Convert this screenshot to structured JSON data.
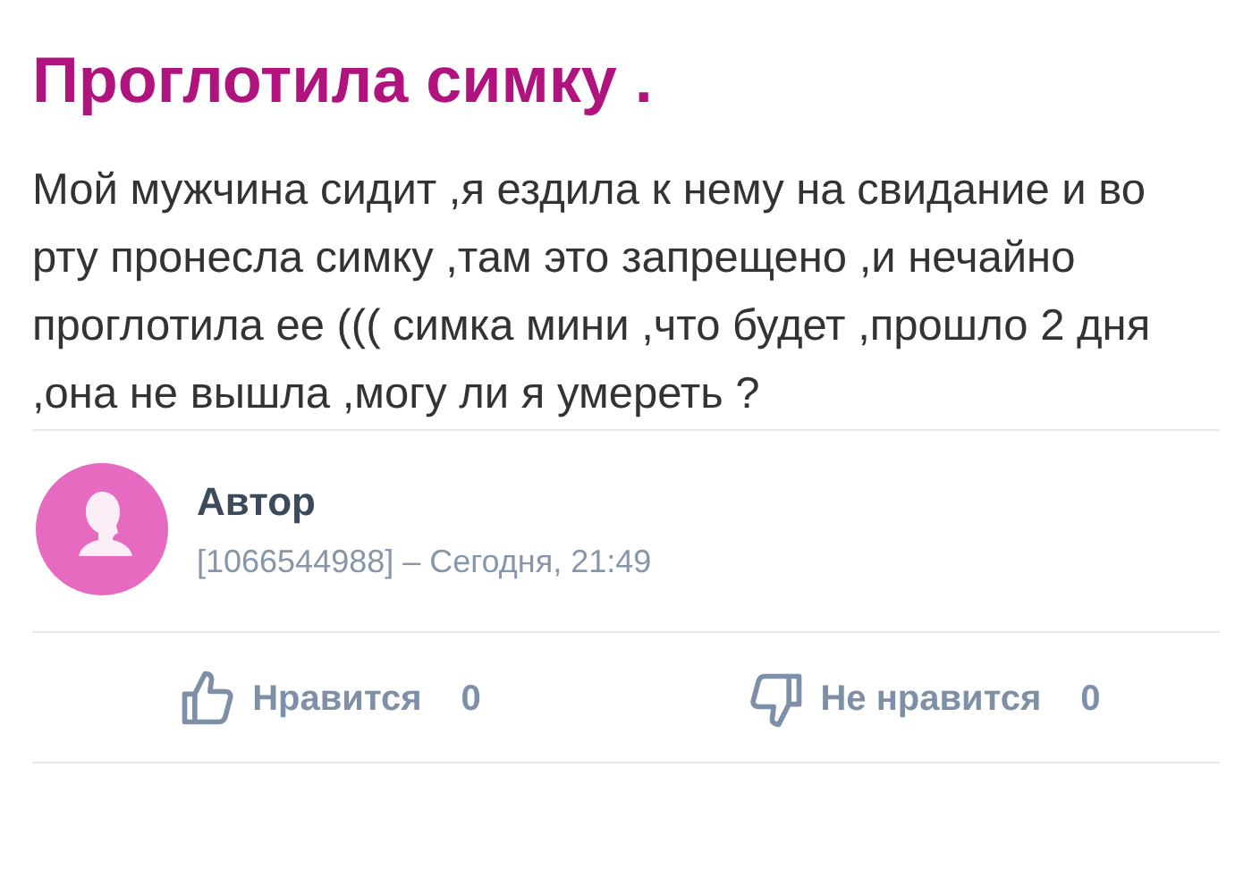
{
  "question": {
    "title": "Проглотила симку .",
    "body": "Мой мужчина сидит ,я ездила к нему на свидание и во рту пронесла симку ,там это запрещено ,и нечайно проглотила ее ((( симка мини ,что будет ,прошло 2 дня ,она не вышла ,могу ли я умереть ?"
  },
  "author": {
    "name": "Автор",
    "meta": "[1066544988] – Сегодня, 21:49"
  },
  "reactions": [
    {
      "kind": "like",
      "label": "Нравится",
      "count": "0"
    },
    {
      "kind": "dislike",
      "label": "Не нравится",
      "count": "0"
    }
  ]
}
